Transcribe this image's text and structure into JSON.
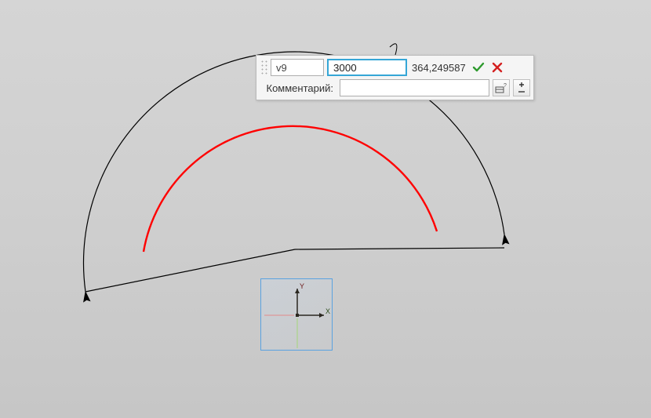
{
  "panel": {
    "variable": "v9",
    "value": "3000",
    "computed": "364,249587",
    "comment_label": "Комментарий:",
    "comment_value": ""
  },
  "icons": {
    "confirm": "confirm-checkmark",
    "cancel": "cancel-x",
    "edit": "edit-query",
    "toggle": "plus-minus"
  },
  "axes": {
    "x": "X",
    "y": "Y"
  },
  "colors": {
    "arc_near": "#ff0000",
    "arc_far": "#000000",
    "confirm": "#2e9a2e",
    "cancel": "#d42020",
    "csys_border": "#5aa2e0"
  }
}
